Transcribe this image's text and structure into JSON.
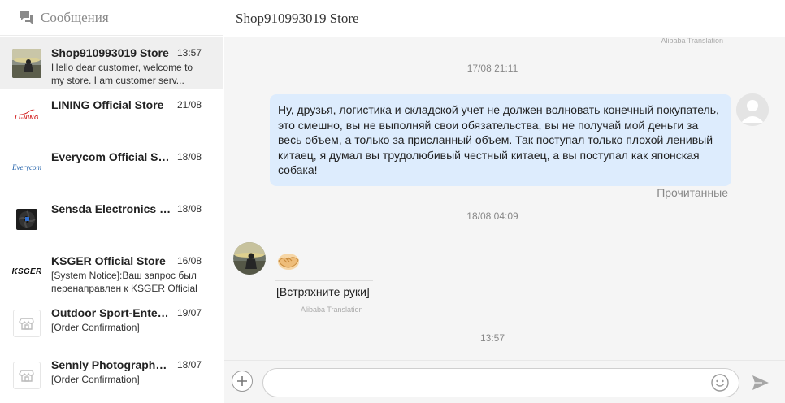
{
  "sidebar": {
    "title": "Сообщения",
    "icon": "chat-bubbles-icon",
    "conversations": [
      {
        "name": "Shop910993019 Store",
        "time": "13:57",
        "preview": "Hello dear customer, welcome to my store. I am customer serv...",
        "avatar": "photo-avatar",
        "active": true
      },
      {
        "name": "LINING Official Store",
        "time": "21/08",
        "preview": "",
        "avatar": "lining-logo",
        "logo_text": "LI-NING"
      },
      {
        "name": "Everycom Official Store",
        "time": "18/08",
        "preview": "",
        "avatar": "everycom-logo",
        "logo_text": "Everycom"
      },
      {
        "name": "Sensda Electronics Store",
        "time": "18/08",
        "preview": "",
        "avatar": "fan-product-image"
      },
      {
        "name": "KSGER Official Store",
        "time": "16/08",
        "preview": "[System Notice]:Ваш запрос был перенаправлен к KSGER Official Store",
        "avatar": "ksger-logo",
        "logo_text": "KSGER"
      },
      {
        "name": "Outdoor Sport-Entertainment Store",
        "time": "19/07",
        "preview": "[Order Confirmation]",
        "avatar": "store-icon"
      },
      {
        "name": "Sennly Photography Store",
        "time": "18/07",
        "preview": "[Order Confirmation]",
        "avatar": "store-icon"
      }
    ]
  },
  "chat": {
    "title": "Shop910993019 Store",
    "top_translation_note": "Alibaba Translation",
    "messages": [
      {
        "type": "time",
        "text": "17/08 21:11"
      },
      {
        "type": "outgoing",
        "text": "Ну, друзья, логистика и складской учет не должен волновать конечный покупатель, это смешно, вы не выполняй свои обязательства, вы не получай мой деньги за весь объем, а только за присланный объем. Так поступал только плохой ленивый китаец, я думал вы трудолюбивый честный китаец, а вы поступал как японская собака!",
        "status": "Прочитанные"
      },
      {
        "type": "time",
        "text": "18/08 04:09"
      },
      {
        "type": "incoming",
        "emoji": "handshake-emoji",
        "text": "[Встряхните руки]",
        "translation_note": "Alibaba Translation"
      },
      {
        "type": "time",
        "text": "13:57"
      }
    ]
  },
  "composer": {
    "input_value": "",
    "placeholder": ""
  },
  "colors": {
    "outgoing_bubble": "#ddecfd",
    "chat_background": "#f5f5f5",
    "active_conversation": "#efefef",
    "lining_red": "#d32222",
    "everycom_blue": "#1f5fa8"
  }
}
